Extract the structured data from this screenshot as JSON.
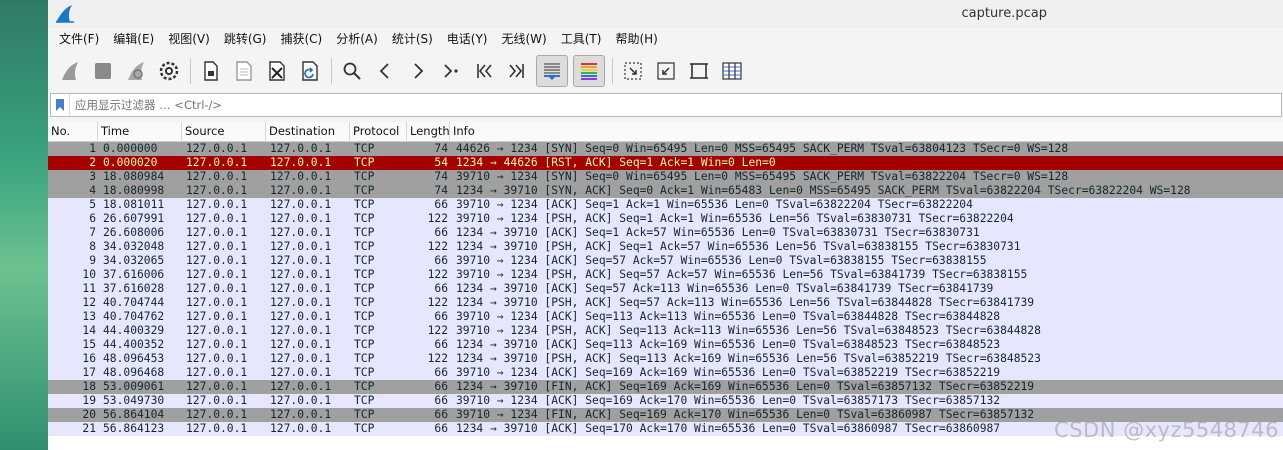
{
  "window": {
    "title": "capture.pcap"
  },
  "menu": [
    "文件(F)",
    "编辑(E)",
    "视图(V)",
    "跳转(G)",
    "捕获(C)",
    "分析(A)",
    "统计(S)",
    "电话(Y)",
    "无线(W)",
    "工具(T)",
    "帮助(H)"
  ],
  "toolbar": {
    "buttons": [
      "start-capture-fin-icon",
      "stop-capture-square-icon",
      "restart-capture-fin-icon",
      "capture-options-gear-icon",
      "open-file-icon",
      "save-file-icon",
      "close-file-icon",
      "reload-file-icon",
      "find-packet-magnifier-icon",
      "go-back-chevron-icon",
      "go-forward-chevron-icon",
      "go-to-packet-icon",
      "go-first-packet-icon",
      "go-last-packet-icon",
      "autoscroll-icon",
      "colorize-icon",
      "zoom-in-icon",
      "zoom-out-icon",
      "normal-size-icon",
      "resize-columns-icon"
    ],
    "active": [
      "autoscroll-icon",
      "colorize-icon"
    ]
  },
  "filter": {
    "placeholder": "应用显示过滤器 … <Ctrl-/>"
  },
  "columns": [
    "No.",
    "Time",
    "Source",
    "Destination",
    "Protocol",
    "Length",
    "Info"
  ],
  "colors": {
    "tcp_row": "#e7e6ff",
    "syn_fin_row": "#a0a0a0",
    "selected_bg": "#a40000",
    "selected_fg": "#fffc9c"
  },
  "packets": [
    {
      "no": "1",
      "time": "0.000000",
      "src": "127.0.0.1",
      "dst": "127.0.0.1",
      "proto": "TCP",
      "len": "74",
      "info": "44626 → 1234 [SYN] Seq=0 Win=65495 Len=0 MSS=65495 SACK_PERM TSval=63804123 TSecr=0 WS=128",
      "style": "gray"
    },
    {
      "no": "2",
      "time": "0.000020",
      "src": "127.0.0.1",
      "dst": "127.0.0.1",
      "proto": "TCP",
      "len": "54",
      "info": "1234 → 44626 [RST, ACK] Seq=1 Ack=1 Win=0 Len=0",
      "style": "sel"
    },
    {
      "no": "3",
      "time": "18.080984",
      "src": "127.0.0.1",
      "dst": "127.0.0.1",
      "proto": "TCP",
      "len": "74",
      "info": "39710 → 1234 [SYN] Seq=0 Win=65495 Len=0 MSS=65495 SACK_PERM TSval=63822204 TSecr=0 WS=128",
      "style": "gray"
    },
    {
      "no": "4",
      "time": "18.080998",
      "src": "127.0.0.1",
      "dst": "127.0.0.1",
      "proto": "TCP",
      "len": "74",
      "info": "1234 → 39710 [SYN, ACK] Seq=0 Ack=1 Win=65483 Len=0 MSS=65495 SACK_PERM TSval=63822204 TSecr=63822204 WS=128",
      "style": "gray"
    },
    {
      "no": "5",
      "time": "18.081011",
      "src": "127.0.0.1",
      "dst": "127.0.0.1",
      "proto": "TCP",
      "len": "66",
      "info": "39710 → 1234 [ACK] Seq=1 Ack=1 Win=65536 Len=0 TSval=63822204 TSecr=63822204",
      "style": "tcp"
    },
    {
      "no": "6",
      "time": "26.607991",
      "src": "127.0.0.1",
      "dst": "127.0.0.1",
      "proto": "TCP",
      "len": "122",
      "info": "39710 → 1234 [PSH, ACK] Seq=1 Ack=1 Win=65536 Len=56 TSval=63830731 TSecr=63822204",
      "style": "tcp"
    },
    {
      "no": "7",
      "time": "26.608006",
      "src": "127.0.0.1",
      "dst": "127.0.0.1",
      "proto": "TCP",
      "len": "66",
      "info": "1234 → 39710 [ACK] Seq=1 Ack=57 Win=65536 Len=0 TSval=63830731 TSecr=63830731",
      "style": "tcp"
    },
    {
      "no": "8",
      "time": "34.032048",
      "src": "127.0.0.1",
      "dst": "127.0.0.1",
      "proto": "TCP",
      "len": "122",
      "info": "1234 → 39710 [PSH, ACK] Seq=1 Ack=57 Win=65536 Len=56 TSval=63838155 TSecr=63830731",
      "style": "tcp"
    },
    {
      "no": "9",
      "time": "34.032065",
      "src": "127.0.0.1",
      "dst": "127.0.0.1",
      "proto": "TCP",
      "len": "66",
      "info": "39710 → 1234 [ACK] Seq=57 Ack=57 Win=65536 Len=0 TSval=63838155 TSecr=63838155",
      "style": "tcp"
    },
    {
      "no": "10",
      "time": "37.616006",
      "src": "127.0.0.1",
      "dst": "127.0.0.1",
      "proto": "TCP",
      "len": "122",
      "info": "39710 → 1234 [PSH, ACK] Seq=57 Ack=57 Win=65536 Len=56 TSval=63841739 TSecr=63838155",
      "style": "tcp"
    },
    {
      "no": "11",
      "time": "37.616028",
      "src": "127.0.0.1",
      "dst": "127.0.0.1",
      "proto": "TCP",
      "len": "66",
      "info": "1234 → 39710 [ACK] Seq=57 Ack=113 Win=65536 Len=0 TSval=63841739 TSecr=63841739",
      "style": "tcp"
    },
    {
      "no": "12",
      "time": "40.704744",
      "src": "127.0.0.1",
      "dst": "127.0.0.1",
      "proto": "TCP",
      "len": "122",
      "info": "1234 → 39710 [PSH, ACK] Seq=57 Ack=113 Win=65536 Len=56 TSval=63844828 TSecr=63841739",
      "style": "tcp"
    },
    {
      "no": "13",
      "time": "40.704762",
      "src": "127.0.0.1",
      "dst": "127.0.0.1",
      "proto": "TCP",
      "len": "66",
      "info": "39710 → 1234 [ACK] Seq=113 Ack=113 Win=65536 Len=0 TSval=63844828 TSecr=63844828",
      "style": "tcp"
    },
    {
      "no": "14",
      "time": "44.400329",
      "src": "127.0.0.1",
      "dst": "127.0.0.1",
      "proto": "TCP",
      "len": "122",
      "info": "39710 → 1234 [PSH, ACK] Seq=113 Ack=113 Win=65536 Len=56 TSval=63848523 TSecr=63844828",
      "style": "tcp"
    },
    {
      "no": "15",
      "time": "44.400352",
      "src": "127.0.0.1",
      "dst": "127.0.0.1",
      "proto": "TCP",
      "len": "66",
      "info": "1234 → 39710 [ACK] Seq=113 Ack=169 Win=65536 Len=0 TSval=63848523 TSecr=63848523",
      "style": "tcp"
    },
    {
      "no": "16",
      "time": "48.096453",
      "src": "127.0.0.1",
      "dst": "127.0.0.1",
      "proto": "TCP",
      "len": "122",
      "info": "1234 → 39710 [PSH, ACK] Seq=113 Ack=169 Win=65536 Len=56 TSval=63852219 TSecr=63848523",
      "style": "tcp"
    },
    {
      "no": "17",
      "time": "48.096468",
      "src": "127.0.0.1",
      "dst": "127.0.0.1",
      "proto": "TCP",
      "len": "66",
      "info": "39710 → 1234 [ACK] Seq=169 Ack=169 Win=65536 Len=0 TSval=63852219 TSecr=63852219",
      "style": "tcp"
    },
    {
      "no": "18",
      "time": "53.009061",
      "src": "127.0.0.1",
      "dst": "127.0.0.1",
      "proto": "TCP",
      "len": "66",
      "info": "1234 → 39710 [FIN, ACK] Seq=169 Ack=169 Win=65536 Len=0 TSval=63857132 TSecr=63852219",
      "style": "gray"
    },
    {
      "no": "19",
      "time": "53.049730",
      "src": "127.0.0.1",
      "dst": "127.0.0.1",
      "proto": "TCP",
      "len": "66",
      "info": "39710 → 1234 [ACK] Seq=169 Ack=170 Win=65536 Len=0 TSval=63857173 TSecr=63857132",
      "style": "tcp"
    },
    {
      "no": "20",
      "time": "56.864104",
      "src": "127.0.0.1",
      "dst": "127.0.0.1",
      "proto": "TCP",
      "len": "66",
      "info": "39710 → 1234 [FIN, ACK] Seq=169 Ack=170 Win=65536 Len=0 TSval=63860987 TSecr=63857132",
      "style": "gray"
    },
    {
      "no": "21",
      "time": "56.864123",
      "src": "127.0.0.1",
      "dst": "127.0.0.1",
      "proto": "TCP",
      "len": "66",
      "info": "1234 → 39710 [ACK] Seq=170 Ack=170 Win=65536 Len=0 TSval=63860987 TSecr=63860987",
      "style": "tcp"
    }
  ],
  "watermark": "CSDN @xyz5548746"
}
